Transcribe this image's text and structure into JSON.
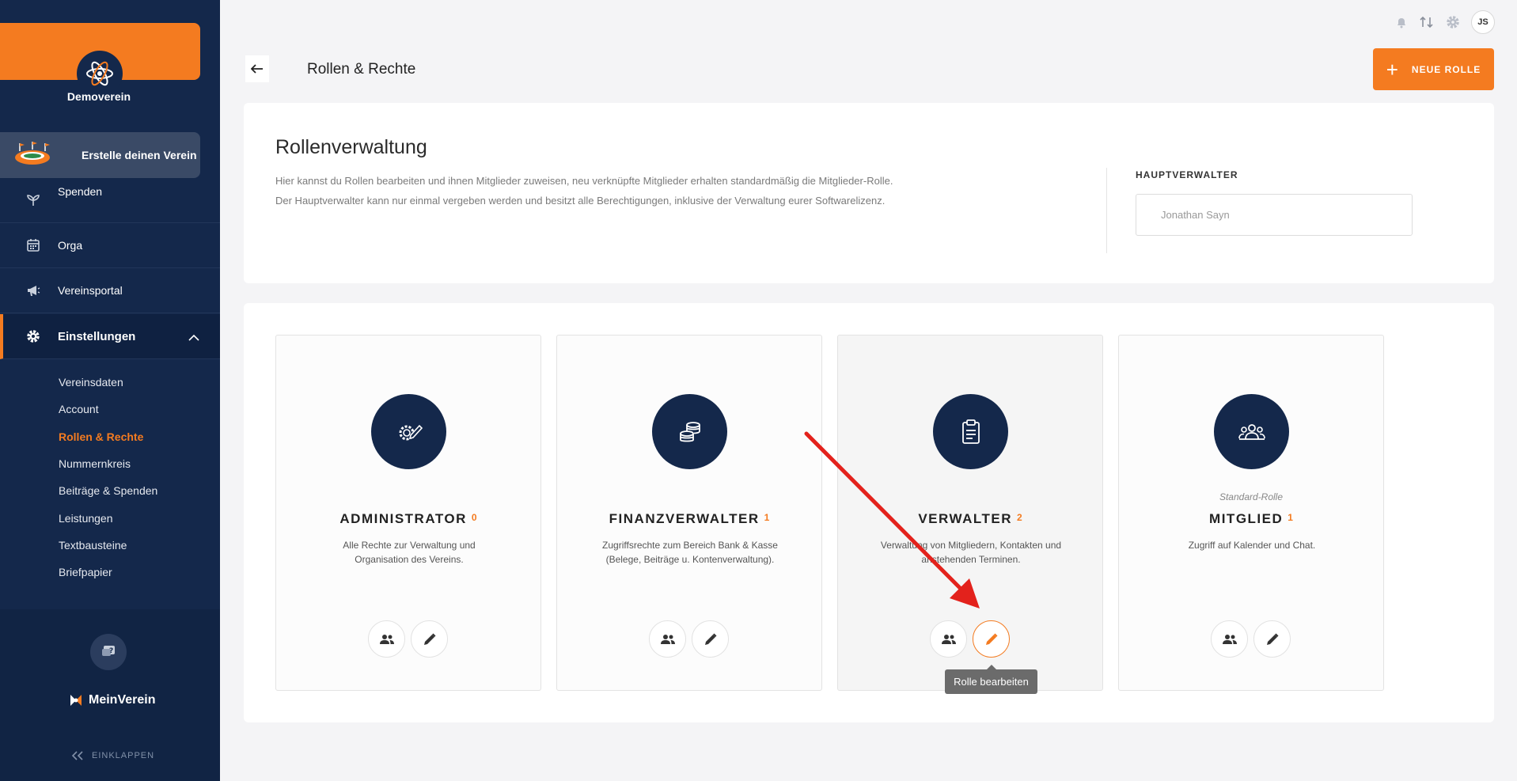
{
  "sidebar": {
    "club_name": "Demoverein",
    "promo_label": "Erstelle deinen Verein",
    "nav": [
      {
        "label": "Spenden",
        "icon": "seedling-icon"
      },
      {
        "label": "Orga",
        "icon": "calendar-icon"
      },
      {
        "label": "Vereinsportal",
        "icon": "megaphone-icon"
      },
      {
        "label": "Einstellungen",
        "icon": "gear-icon"
      }
    ],
    "sub_items": [
      "Vereinsdaten",
      "Account",
      "Rollen & Rechte",
      "Nummernkreis",
      "Beiträge & Spenden",
      "Leistungen",
      "Textbausteine",
      "Briefpapier"
    ],
    "active_sub": "Rollen & Rechte",
    "brand": "MeinVerein",
    "collapse_label": "EINKLAPPEN"
  },
  "header": {
    "page_title": "Rollen & Rechte",
    "new_role_label": "NEUE ROLLE",
    "avatar_initials": "JS"
  },
  "info": {
    "title": "Rollenverwaltung",
    "desc_line1": "Hier kannst du Rollen bearbeiten und ihnen Mitglieder zuweisen, neu verknüpfte Mitglieder erhalten standardmäßig die Mitglieder-Rolle.",
    "desc_line2": "Der Hauptverwalter kann nur einmal vergeben werden und besitzt alle Berechtigungen, inklusive der Verwaltung eurer Softwarelizenz.",
    "hv_label": "HAUPTVERWALTER",
    "hv_value": "Jonathan Sayn"
  },
  "roles": [
    {
      "name": "ADMINISTRATOR",
      "count": "0",
      "icon": "gear-pen-icon",
      "tag": "",
      "desc_line1": "Alle Rechte zur Verwaltung und",
      "desc_line2": "Organisation des Vereins."
    },
    {
      "name": "FINANZVERWALTER",
      "count": "1",
      "icon": "coins-icon",
      "tag": "",
      "desc_line1": "Zugriffsrechte zum Bereich Bank & Kasse",
      "desc_line2": "(Belege, Beiträge u. Kontenverwaltung)."
    },
    {
      "name": "VERWALTER",
      "count": "2",
      "icon": "clipboard-icon",
      "tag": "",
      "desc_line1": "Verwaltung von Mitgliedern, Kontakten und",
      "desc_line2": "anstehenden Terminen."
    },
    {
      "name": "MITGLIED",
      "count": "1",
      "icon": "group-icon",
      "tag": "Standard-Rolle",
      "desc_line1": "Zugriff auf Kalender und Chat.",
      "desc_line2": ""
    }
  ],
  "tooltip": "Rolle bearbeiten",
  "colors": {
    "accent": "#f47b20",
    "navy": "#14284b",
    "annotation_arrow": "#e3221c"
  }
}
